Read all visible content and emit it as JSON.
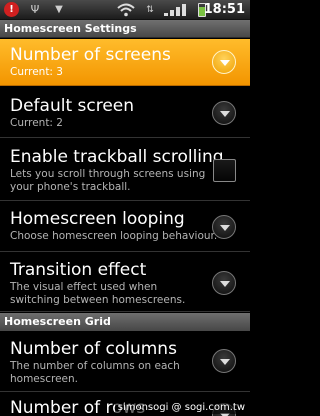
{
  "status_bar": {
    "time": "18:51",
    "icons": [
      "alert-icon",
      "usb-icon",
      "wifi-icon",
      "signal-icon",
      "battery-icon"
    ]
  },
  "title_bar": {
    "title": "Homescreen Settings"
  },
  "preferences": [
    {
      "title": "Number of screens",
      "summary": "Current: 3",
      "widget": "dropdown",
      "selected": true
    },
    {
      "title": "Default screen",
      "summary": "Current: 2",
      "widget": "dropdown",
      "selected": false
    },
    {
      "title": "Enable trackball scrolling",
      "summary": "Lets you scroll through screens using your phone's trackball.",
      "widget": "checkbox",
      "checked": false
    },
    {
      "title": "Homescreen looping",
      "summary": "Choose homescreen looping behaviour.",
      "widget": "dropdown"
    },
    {
      "title": "Transition effect",
      "summary": "The visual effect used when switching between homescreens.",
      "widget": "dropdown"
    }
  ],
  "category_grid": {
    "title": "Homescreen Grid"
  },
  "grid_preferences": [
    {
      "title": "Number of columns",
      "summary": "The number of columns on each homescreen.",
      "widget": "dropdown"
    },
    {
      "title": "Number of rows",
      "widget": "dropdown"
    }
  ],
  "watermark": "simonsogi @ sogi.com.tw",
  "colors": {
    "selected_orange": "#f7a51c",
    "background": "#000000",
    "header_gray": "#5a5a5a"
  }
}
